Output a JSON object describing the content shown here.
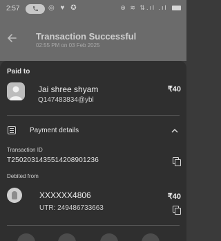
{
  "status_bar": {
    "time": "2:57",
    "left_icons": "◎ ♥ ✪",
    "right_icons": "⊛ ≋ ⇅.ıl .ıl"
  },
  "header": {
    "title": "Transaction Successful",
    "subtitle": "02:55 PM on 03 Feb 2025",
    "back_icon": "back-arrow-icon"
  },
  "paid_to": {
    "label": "Paid to",
    "name": "Jai shree shyam",
    "upi_id": "Q147483834@ybl",
    "amount": "₹40"
  },
  "payment_details": {
    "label": "Payment details",
    "expanded": true,
    "transaction_id_label": "Transaction ID",
    "transaction_id": "T2502031435514208901236",
    "debited_from_label": "Debited from",
    "account": "XXXXXX4806",
    "account_amount": "₹40",
    "utr": "UTR: 249486733663"
  },
  "colors": {
    "header_bg": "#6b6b6b",
    "card_bg": "#2f2f2f",
    "text": "#e9e9e9"
  }
}
